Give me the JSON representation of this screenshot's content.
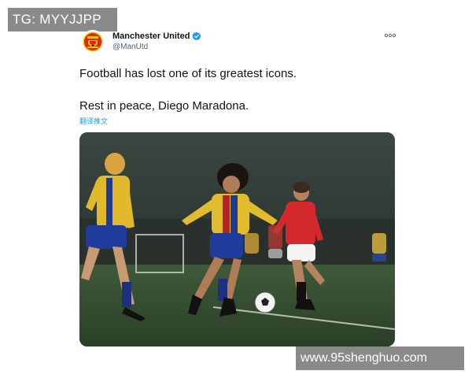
{
  "watermark_top": "TG: MYYJJPP",
  "watermark_bottom": "www.95shenghuo.com",
  "tweet": {
    "author": {
      "display_name": "Manchester United",
      "handle": "@ManUtd",
      "verified": true,
      "avatar_icon": "manchester-united-crest"
    },
    "more_icon": "more-horizontal-icon",
    "text_line_1": "Football has lost one of its greatest icons.",
    "text_line_2": "Rest in peace, Diego Maradona.",
    "translate_label": "翻译推文",
    "media": {
      "description_icon": "football-match-photo"
    }
  },
  "colors": {
    "link_blue": "#1d9bf0",
    "verified_blue": "#1d9bf0",
    "secondary_text": "#536471",
    "watermark_bg": "#8a8a8a"
  }
}
